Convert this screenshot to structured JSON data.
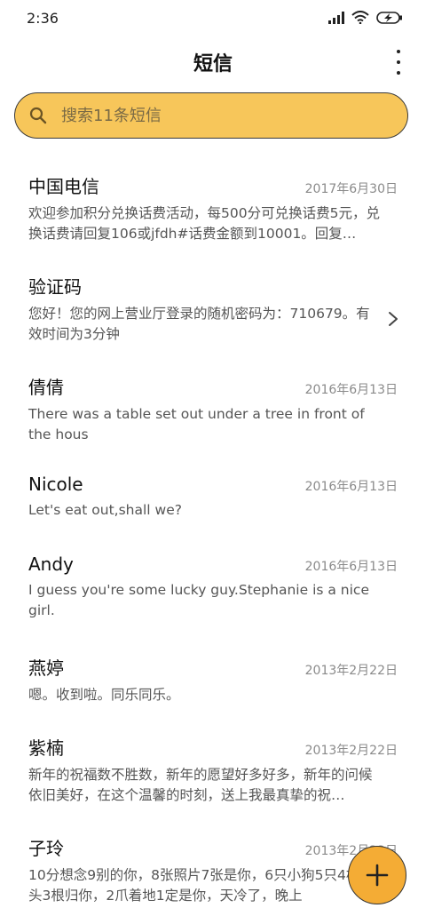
{
  "status_bar": {
    "time": "2:36"
  },
  "header": {
    "title": "短信"
  },
  "search": {
    "placeholder": "搜索11条短信"
  },
  "messages": [
    {
      "name": "中国电信",
      "date": "2017年6月30日",
      "preview": "欢迎参加积分兑换话费活动，每500分可兑换话费5元，兑换话费请回复106或jfdh#话费金额到10001。回复…"
    },
    {
      "name": "验证码",
      "date": "",
      "preview": "您好！您的网上营业厅登录的随机密码为：710679。有效时间为3分钟"
    },
    {
      "name": "倩倩",
      "date": "2016年6月13日",
      "preview": "There was a table set out under a tree in front of the hous"
    },
    {
      "name": "Nicole",
      "date": "2016年6月13日",
      "preview": "Let's eat out,shall we?"
    },
    {
      "name": "Andy",
      "date": "2016年6月13日",
      "preview": "I guess you're some lucky guy.Stephanie is a nice girl."
    },
    {
      "name": "燕婷",
      "date": "2013年2月22日",
      "preview": "嗯。收到啦。同乐同乐。"
    },
    {
      "name": "紫楠",
      "date": "2013年2月22日",
      "preview": "新年的祝福数不胜数，新年的愿望好多好多，新年的问候依旧美好，在这个温馨的时刻，送上我最真挚的祝…"
    },
    {
      "name": "子玲",
      "date": "2013年2月22日",
      "preview": "10分想念9别的你，8张照片7张是你，6只小狗5只4根骨头3根归你，2爪着地1定是你，天冷了，晚上"
    }
  ],
  "colors": {
    "search_bg": "#f7c65a",
    "fab_bg": "#f4ac35"
  }
}
